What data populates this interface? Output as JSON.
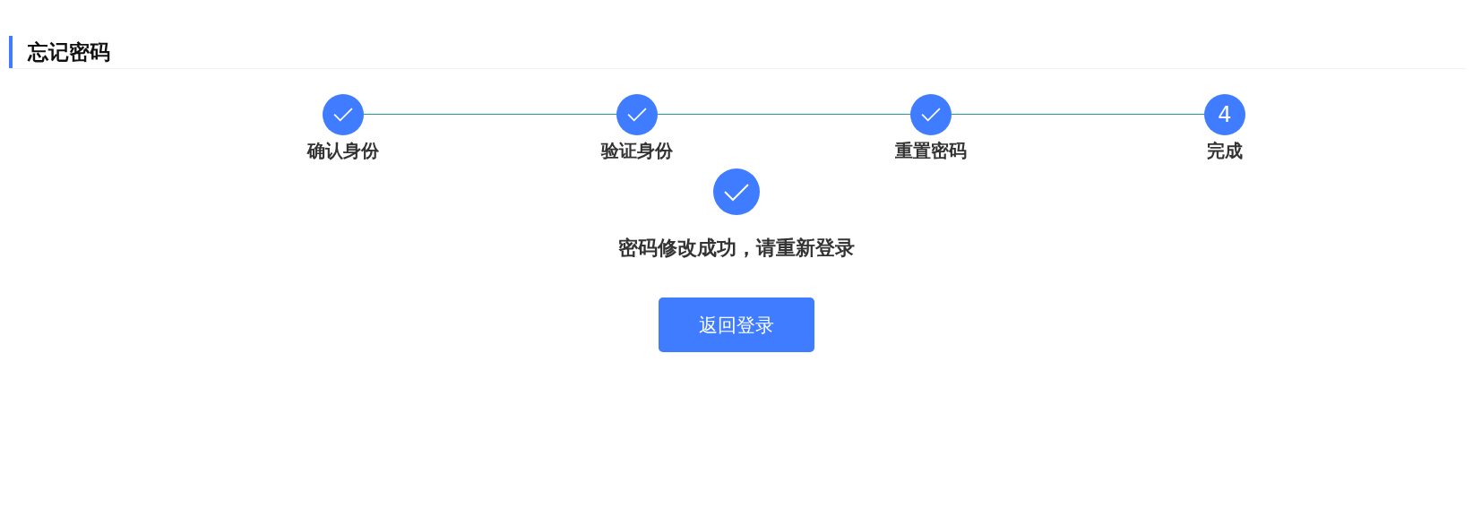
{
  "page_title": "忘记密码",
  "steps": [
    {
      "label": "确认身份",
      "kind": "done"
    },
    {
      "label": "验证身份",
      "kind": "done"
    },
    {
      "label": "重置密码",
      "kind": "done"
    },
    {
      "label": "完成",
      "kind": "current",
      "number": "4"
    }
  ],
  "result": {
    "message": "密码修改成功，请重新登录"
  },
  "button": "返回登录"
}
